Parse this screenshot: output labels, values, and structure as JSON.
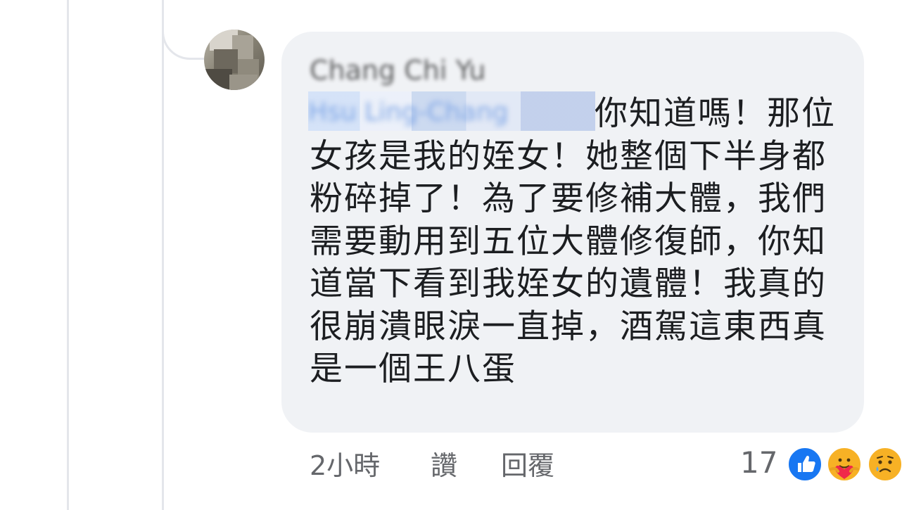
{
  "comment": {
    "author": "Chang Chi Yu",
    "mention": "Hsu Ling-Chang",
    "body_lines": [
      "你知道嗎！那位",
      "女孩是我的姪女！她整個下半身都",
      "粉碎掉了！為了要修補大體，我們",
      "需要動用到五位大體修復師，你知",
      "道當下看到我姪女的遺體！我真的",
      "很崩潰眼淚一直掉，酒駕這東西真",
      "是一個王八蛋"
    ]
  },
  "actions": {
    "time": "2小時",
    "like": "讚",
    "reply": "回覆"
  },
  "reactions": {
    "count": "17",
    "icons": [
      "like-icon",
      "care-icon",
      "sad-icon"
    ]
  },
  "colors": {
    "bubble": "#f0f2f5",
    "like_blue": "#1877f2",
    "emoji_yellow": "#f7b125",
    "secondary_text": "#65676b"
  }
}
